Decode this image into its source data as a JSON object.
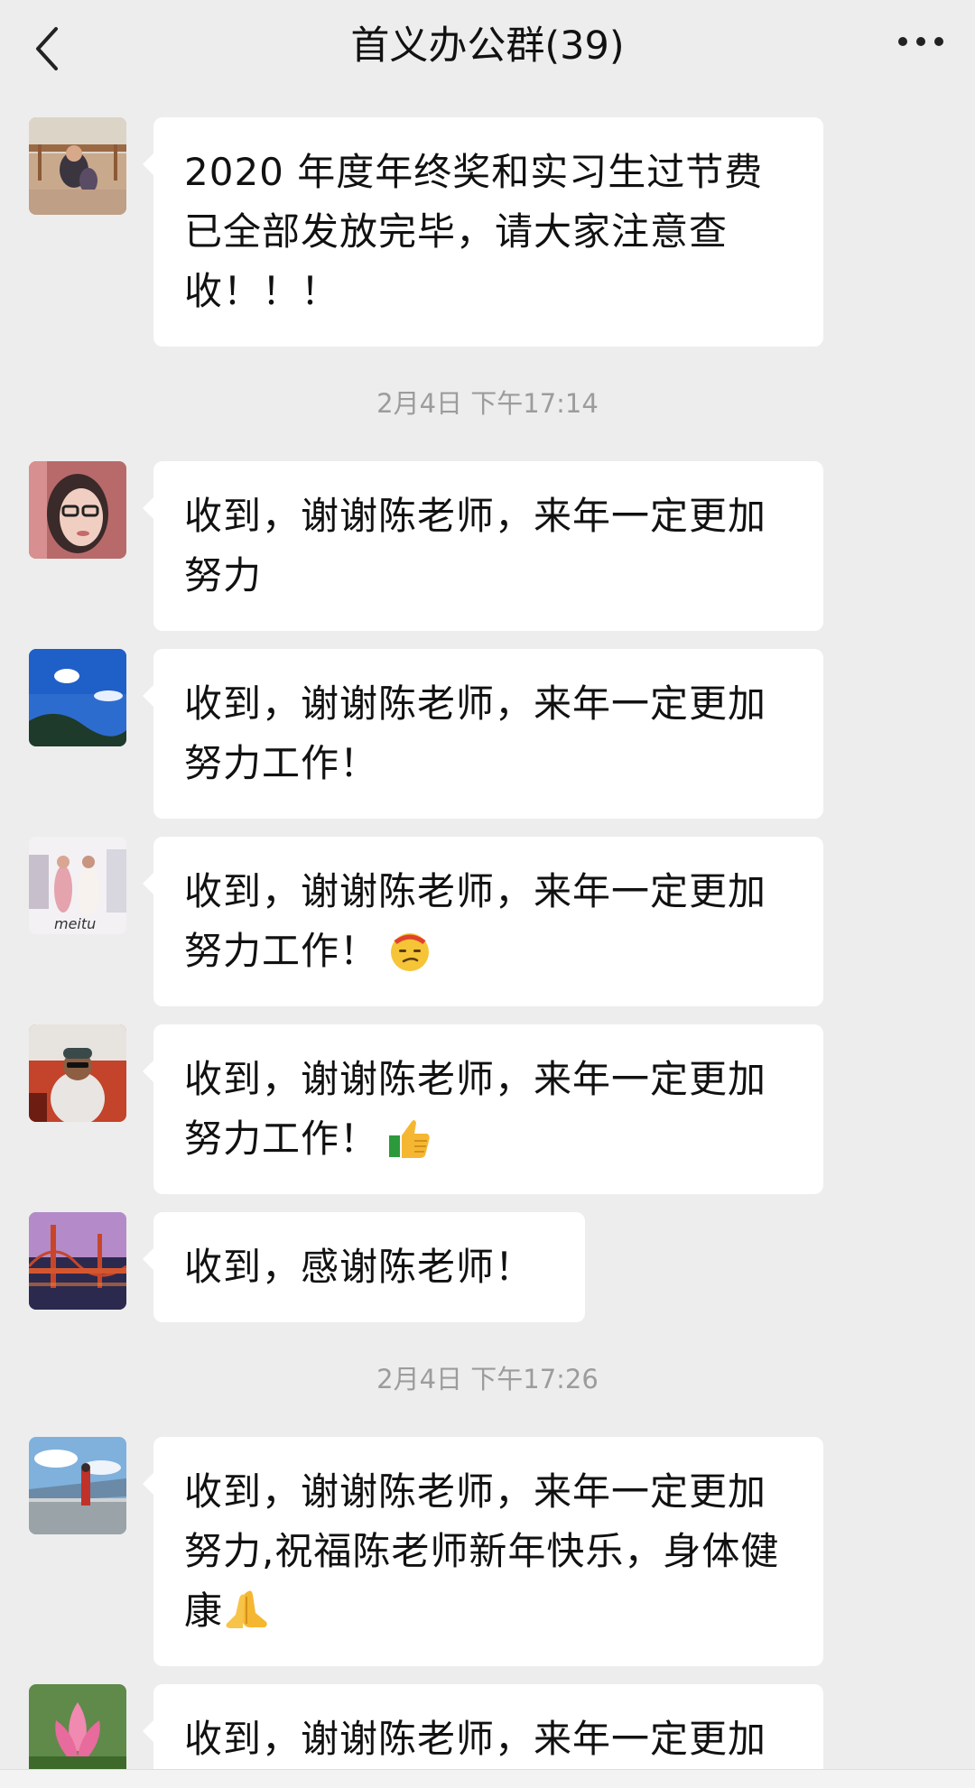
{
  "header": {
    "title": "首义办公群(39)"
  },
  "messages": [
    {
      "text": "2020 年度年终奖和实习生过节费已全部发放完毕，请大家注意查收！！！"
    },
    {
      "text": "收到，谢谢陈老师，来年一定更加努力"
    },
    {
      "text": "收到，谢谢陈老师，来年一定更加努力工作！"
    },
    {
      "text": "收到，谢谢陈老师，来年一定更加努力工作！",
      "emoji": "smirk-face-icon"
    },
    {
      "text": "收到，谢谢陈老师，来年一定更加努力工作！",
      "emoji": "thumbs-up-icon"
    },
    {
      "text": "收到，感谢陈老师！"
    },
    {
      "text": "收到，谢谢陈老师，来年一定更加努力,祝福陈老师新年快乐，身体健康",
      "emoji": "pray-hands-icon"
    },
    {
      "text": "收到，谢谢陈老师，来年一定更加"
    }
  ],
  "timestamps": [
    "2月4日 下午17:14",
    "2月4日 下午17:26"
  ],
  "colors": {
    "background": "#ededed",
    "bubble": "#ffffff",
    "timestamp": "#9c9c9c"
  }
}
